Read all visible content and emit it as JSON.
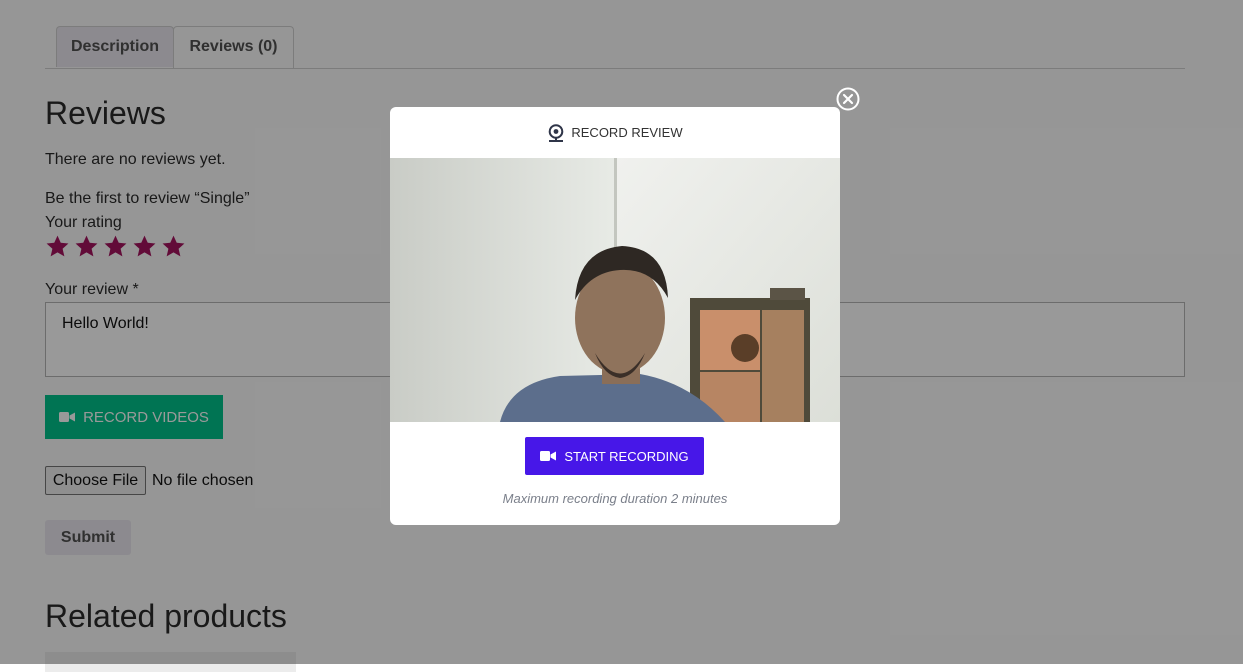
{
  "tabs": [
    {
      "label": "Description"
    },
    {
      "label": "Reviews (0)"
    }
  ],
  "reviews": {
    "heading": "Reviews",
    "no_reviews": "There are no reviews yet.",
    "be_first": "Be the first to review “Single”",
    "rating_label": "Your rating",
    "rating_stars": 5,
    "review_label": "Your review *",
    "review_value": "Hello World!",
    "record_videos_label": "RECORD VIDEOS",
    "choose_file_label": "Choose File",
    "no_file_label": "No file chosen",
    "submit_label": "Submit"
  },
  "related": {
    "heading": "Related products"
  },
  "modal": {
    "title": "RECORD REVIEW",
    "start_label": "START RECORDING",
    "max_note": "Maximum recording duration 2 minutes"
  },
  "icons": {
    "webcam": "webcam-icon",
    "video_camera": "video-camera-icon",
    "close": "close-icon",
    "star": "star-icon"
  },
  "colors": {
    "star": "#a3135e",
    "record_videos_bg": "#00c18a",
    "start_recording_bg": "#4717e8",
    "overlay": "rgba(0,0,0,0.4)"
  }
}
